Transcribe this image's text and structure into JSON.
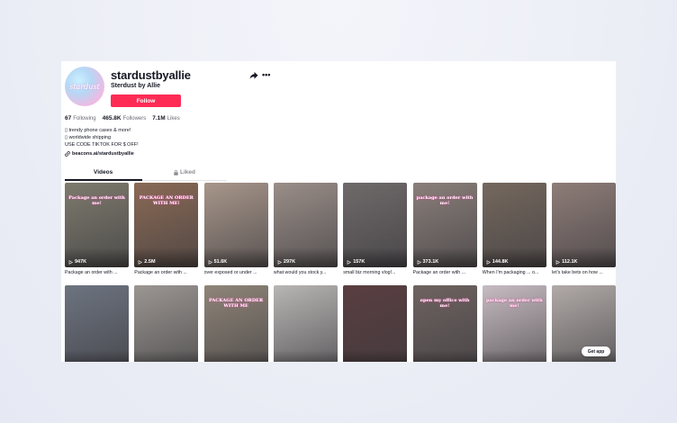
{
  "profile": {
    "avatar_text": "stardust",
    "username": "stardustbyallie",
    "display_name": "Sterdust by Allie",
    "follow_label": "Follow"
  },
  "stats": {
    "following_count": "67",
    "following_label": "Following",
    "followers_count": "465.8K",
    "followers_label": "Followers",
    "likes_count": "7.1M",
    "likes_label": "Likes"
  },
  "bio": {
    "line1": "trendy phone cases & more!",
    "line2": "worldwide shipping",
    "line3": "USE CODE TIKTOK FOR $ OFF!"
  },
  "link": {
    "text": "beacons.ai/stardustbyallie"
  },
  "tabs": {
    "videos": "Videos",
    "liked": "Liked"
  },
  "videos": [
    {
      "views": "947K",
      "caption": "Package an order with ...",
      "overlay": "Package an order with me!",
      "color": "#7d7a6d"
    },
    {
      "views": "2.5M",
      "caption": "Package an order with ...",
      "overlay": "PACKAGE AN ORDER WITH ME!",
      "color": "#8a6a55"
    },
    {
      "views": "51.6K",
      "caption": "over exposed or under ...",
      "overlay": "",
      "color": "#a7968a"
    },
    {
      "views": "297K",
      "caption": "what would you stock y...",
      "overlay": "",
      "color": "#9a8e88"
    },
    {
      "views": "157K",
      "caption": "small biz morning vlog!...",
      "overlay": "",
      "color": "#6f6a6a"
    },
    {
      "views": "373.1K",
      "caption": "Package an order with ...",
      "overlay": "package an order with me!",
      "color": "#8a7f7a"
    },
    {
      "views": "144.8K",
      "caption": "When I'm packaging ... o...",
      "overlay": "",
      "color": "#75685e"
    },
    {
      "views": "112.1K",
      "caption": "let's take bets on how ...",
      "overlay": "",
      "color": "#8e7d78"
    },
    {
      "views": "",
      "caption": "",
      "overlay": "",
      "color": "#6d7480"
    },
    {
      "views": "",
      "caption": "",
      "overlay": "",
      "color": "#9b9692"
    },
    {
      "views": "",
      "caption": "",
      "overlay": "PACKAGE AN ORDER WITH ME",
      "color": "#8f8578"
    },
    {
      "views": "",
      "caption": "",
      "overlay": "",
      "color": "#b8b6b4"
    },
    {
      "views": "",
      "caption": "",
      "overlay": "",
      "color": "#5a3e40"
    },
    {
      "views": "",
      "caption": "",
      "overlay": "open my office with me!",
      "color": "#6e6360"
    },
    {
      "views": "",
      "caption": "",
      "overlay": "package an order with me!",
      "color": "#c7bcc2"
    },
    {
      "views": "",
      "caption": "",
      "overlay": "",
      "color": "#b1aaa8"
    }
  ],
  "get_app": "Get app"
}
